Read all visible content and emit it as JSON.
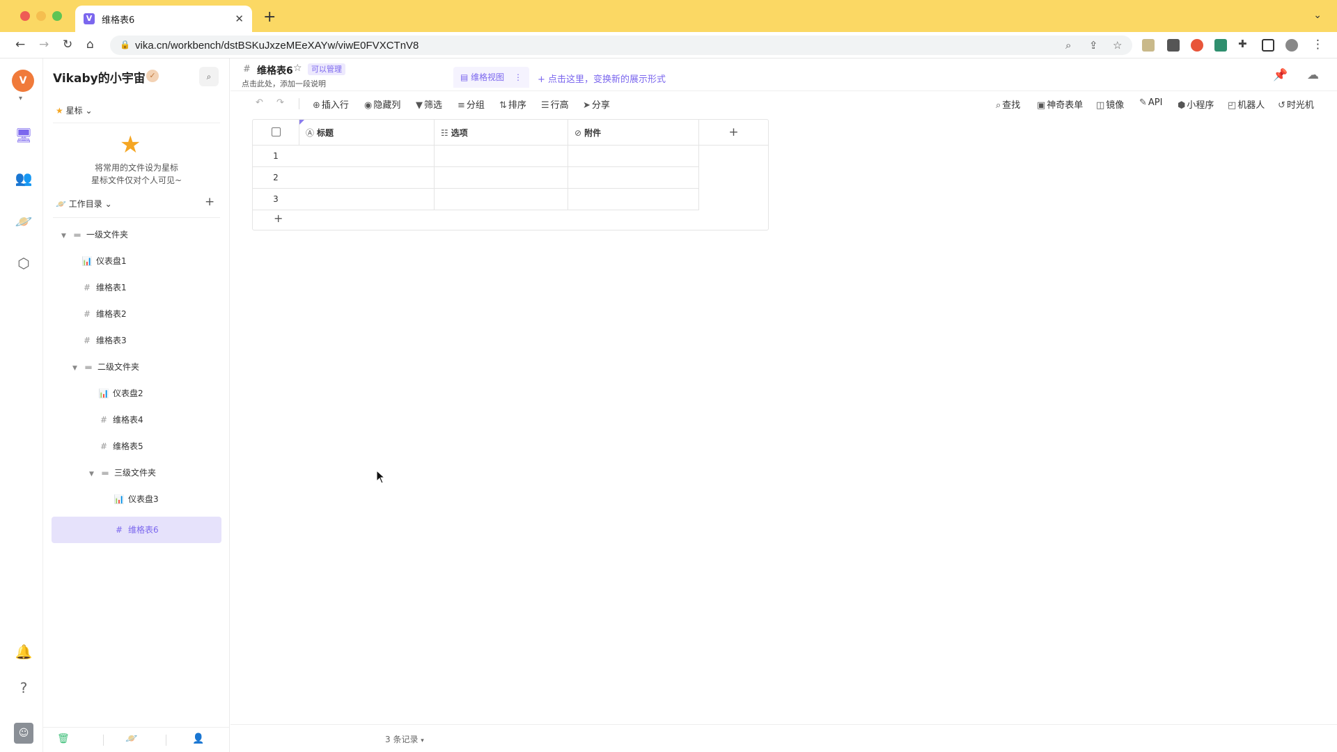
{
  "browser": {
    "tab_title": "维格表6",
    "url": "vika.cn/workbench/dstBSKuJxzeMEeXAYw/viwE0FVXCTnV8"
  },
  "space": {
    "name": "Vikaby的小宇宙"
  },
  "sidebar": {
    "star_header": "星标",
    "star_hint_line1": "将常用的文件设为星标",
    "star_hint_line2": "星标文件仅对个人可见~",
    "workdir_header": "工作目录",
    "tree": [
      {
        "label": "一级文件夹",
        "type": "folder"
      },
      {
        "label": "仪表盘1",
        "type": "dashboard"
      },
      {
        "label": "维格表1",
        "type": "sheet"
      },
      {
        "label": "维格表2",
        "type": "sheet"
      },
      {
        "label": "维格表3",
        "type": "sheet"
      },
      {
        "label": "二级文件夹",
        "type": "folder"
      },
      {
        "label": "仪表盘2",
        "type": "dashboard"
      },
      {
        "label": "维格表4",
        "type": "sheet"
      },
      {
        "label": "维格表5",
        "type": "sheet"
      },
      {
        "label": "三级文件夹",
        "type": "folder"
      },
      {
        "label": "仪表盘3",
        "type": "dashboard"
      },
      {
        "label": "维格表6",
        "type": "sheet",
        "selected": true
      }
    ]
  },
  "datasheet": {
    "title": "维格表6",
    "permission": "可以管理",
    "description": "点击此处，添加一段说明",
    "view_name": "维格视图",
    "add_view": "点击这里，变换新的展示形式"
  },
  "toolbar": {
    "insert_row": "插入行",
    "hide_columns": "隐藏列",
    "filter": "筛选",
    "group": "分组",
    "sort": "排序",
    "row_height": "行高",
    "share": "分享",
    "find": "查找",
    "form": "神奇表单",
    "mirror": "镜像",
    "api": "API",
    "widget": "小程序",
    "robot": "机器人",
    "time_machine": "时光机"
  },
  "grid": {
    "columns": [
      "标题",
      "选项",
      "附件"
    ],
    "row_numbers": [
      "1",
      "2",
      "3"
    ],
    "add_column": "+",
    "add_row": "+"
  },
  "footer": {
    "record_count": "3 条记录"
  },
  "colors": {
    "accent": "#7b67ee",
    "tabbar": "#fbd864"
  }
}
